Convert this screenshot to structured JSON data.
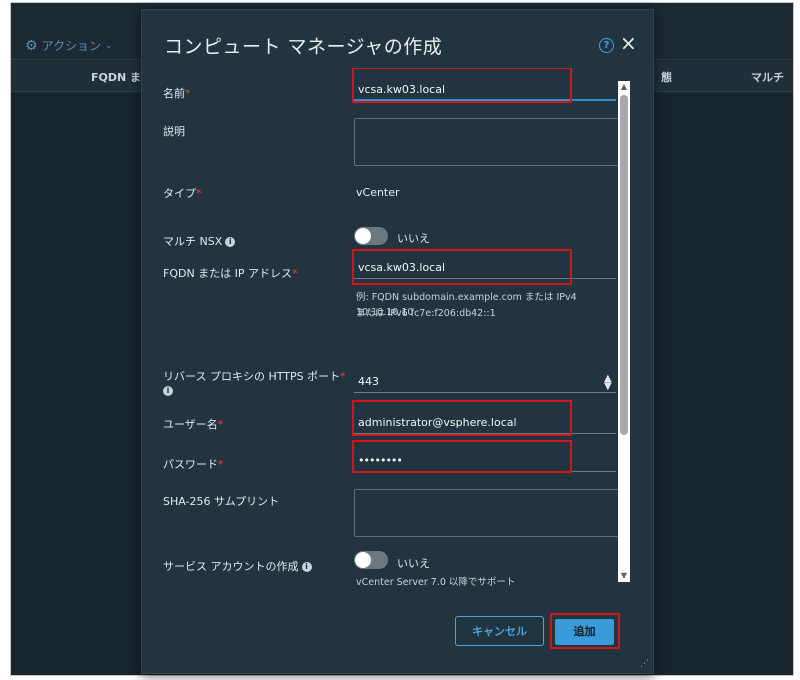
{
  "background": {
    "action_label": "アクション",
    "columns": [
      "FQDN また",
      "態",
      "マルチ"
    ]
  },
  "dialog": {
    "title": "コンピュート マネージャの作成",
    "close_symbol": "×",
    "help_symbol": "?"
  },
  "form": {
    "name": {
      "label": "名前",
      "required": "*",
      "value": "vcsa.kw03.local"
    },
    "description": {
      "label": "説明"
    },
    "type": {
      "label": "タイプ",
      "required": "*",
      "value": "vCenter"
    },
    "multi_nsx": {
      "label": "マルチ NSX",
      "toggle_text": "いいえ"
    },
    "fqdn": {
      "label": "FQDN または IP アドレス",
      "required": "*",
      "value": "vcsa.kw03.local",
      "helper_line1": "例: FQDN subdomain.example.com または IPv4 10.10.10.10",
      "helper_line2": "または IPv6 fc7e:f206:db42::1"
    },
    "https_port": {
      "label": "リバース プロキシの HTTPS ポート",
      "required": "*",
      "value": "443"
    },
    "username": {
      "label": "ユーザー名",
      "required": "*",
      "value": "administrator@vsphere.local"
    },
    "password": {
      "label": "パスワード",
      "required": "*",
      "value": "••••••••"
    },
    "sha256": {
      "label": "SHA-256 サムプリント"
    },
    "service_account": {
      "label": "サービス アカウントの作成",
      "toggle_text": "いいえ",
      "note": "vCenter Server 7.0 以降でサポート"
    }
  },
  "buttons": {
    "cancel": "キャンセル",
    "add": "追加"
  }
}
